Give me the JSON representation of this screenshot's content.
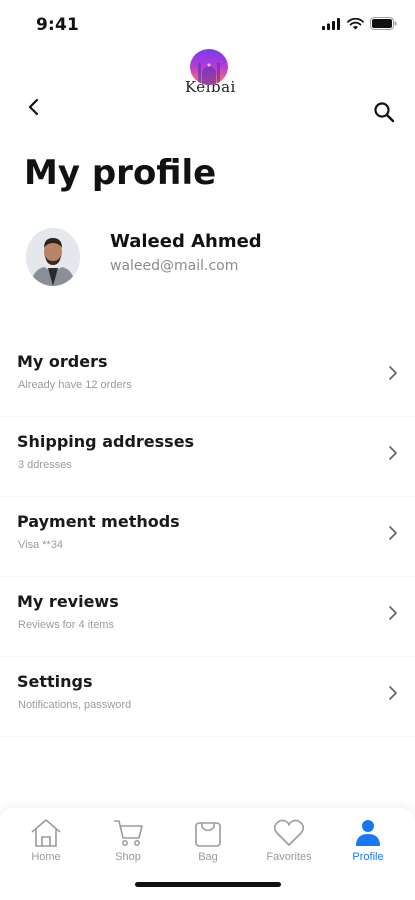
{
  "status_bar": {
    "time": "9:41"
  },
  "app": {
    "logo_text": "Keibai"
  },
  "page": {
    "title": "My profile"
  },
  "user": {
    "name": "Waleed Ahmed",
    "email": "waleed@mail.com"
  },
  "menu": [
    {
      "title": "My orders",
      "subtitle": "Already have 12 orders"
    },
    {
      "title": "Shipping addresses",
      "subtitle": "3 ddresses"
    },
    {
      "title": "Payment methods",
      "subtitle": "Visa  **34"
    },
    {
      "title": "My reviews",
      "subtitle": "Reviews for 4 items"
    },
    {
      "title": "Settings",
      "subtitle": "Notifications, password"
    }
  ],
  "tabs": [
    {
      "label": "Home",
      "icon": "home-icon"
    },
    {
      "label": "Shop",
      "icon": "cart-icon"
    },
    {
      "label": "Bag",
      "icon": "bag-icon"
    },
    {
      "label": "Favorites",
      "icon": "heart-icon"
    },
    {
      "label": "Profile",
      "icon": "profile-icon",
      "active": true
    }
  ],
  "colors": {
    "accent": "#1877f2",
    "inactive": "#9b9b9b"
  }
}
